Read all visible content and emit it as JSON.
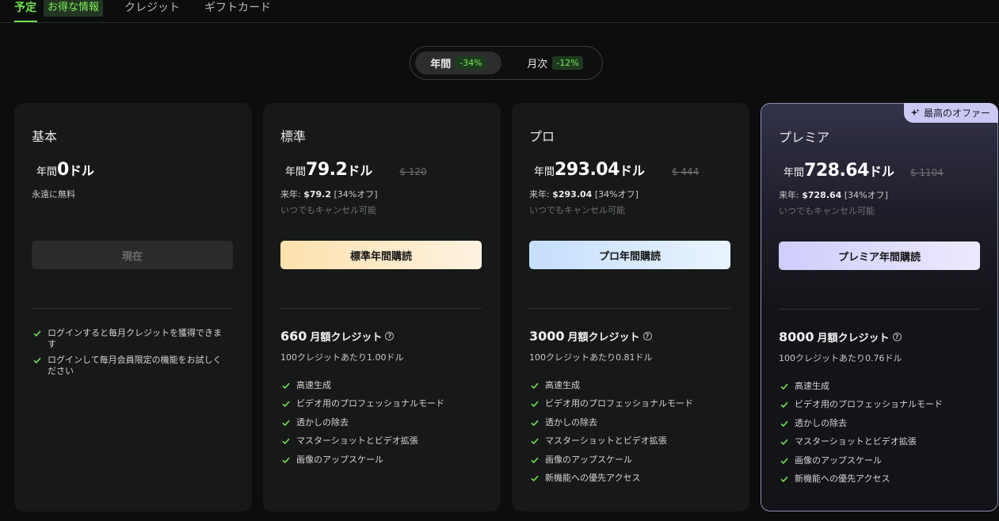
{
  "nav": {
    "tabs": [
      {
        "label": "予定"
      },
      {
        "label": "お得な情報"
      },
      {
        "label": "クレジット"
      },
      {
        "label": "ギフトカード"
      }
    ]
  },
  "billing_toggle": {
    "options": [
      {
        "label": "年間",
        "discount": "-34%",
        "selected": true
      },
      {
        "label": "月次",
        "discount": "-12%",
        "selected": false
      }
    ]
  },
  "plans": [
    {
      "name": "基本",
      "price_prefix": "年間",
      "price": "0",
      "price_unit": "ドル",
      "free_note": "永遠に無料",
      "cta": "現在",
      "features": [
        "ログインすると毎月クレジットを獲得できます",
        "ログインして毎月会員限定の機能をお試しください"
      ]
    },
    {
      "name": "標準",
      "price_prefix": "年間",
      "price": "79.2",
      "price_unit": "ドル",
      "old_price": "$ 120",
      "renew_label": "来年:",
      "renew_price": "$79.2",
      "renew_discount": "[34%オフ]",
      "cancel_note": "いつでもキャンセル可能",
      "cta": "標準年間購読",
      "credits_num": "660",
      "credits_label": "月額クレジット",
      "rate": "100クレジットあたり1.00ドル",
      "features": [
        "高速生成",
        "ビデオ用のプロフェッショナルモード",
        "透かしの除去",
        "マスターショットとビデオ拡張",
        "画像のアップスケール"
      ]
    },
    {
      "name": "プロ",
      "price_prefix": "年間",
      "price": "293.04",
      "price_unit": "ドル",
      "old_price": "$ 444",
      "renew_label": "来年:",
      "renew_price": "$293.04",
      "renew_discount": "[34%オフ]",
      "cancel_note": "いつでもキャンセル可能",
      "cta": "プロ年間購読",
      "credits_num": "3000",
      "credits_label": "月額クレジット",
      "rate": "100クレジットあたり0.81ドル",
      "features": [
        "高速生成",
        "ビデオ用のプロフェッショナルモード",
        "透かしの除去",
        "マスターショットとビデオ拡張",
        "画像のアップスケール",
        "新機能への優先アクセス"
      ]
    },
    {
      "name": "プレミア",
      "badge": "最高のオファー",
      "price_prefix": "年間",
      "price": "728.64",
      "price_unit": "ドル",
      "old_price": "$ 1104",
      "renew_label": "来年:",
      "renew_price": "$728.64",
      "renew_discount": "[34%オフ]",
      "cancel_note": "いつでもキャンセル可能",
      "cta": "プレミア年間購読",
      "credits_num": "8000",
      "credits_label": "月額クレジット",
      "rate": "100クレジットあたり0.76ドル",
      "features": [
        "高速生成",
        "ビデオ用のプロフェッショナルモード",
        "透かしの除去",
        "マスターショットとビデオ拡張",
        "画像のアップスケール",
        "新機能への優先アクセス"
      ]
    }
  ],
  "colors": {
    "accent_green": "#6ee54b",
    "background": "#0c0d0d",
    "card": "#171919"
  }
}
